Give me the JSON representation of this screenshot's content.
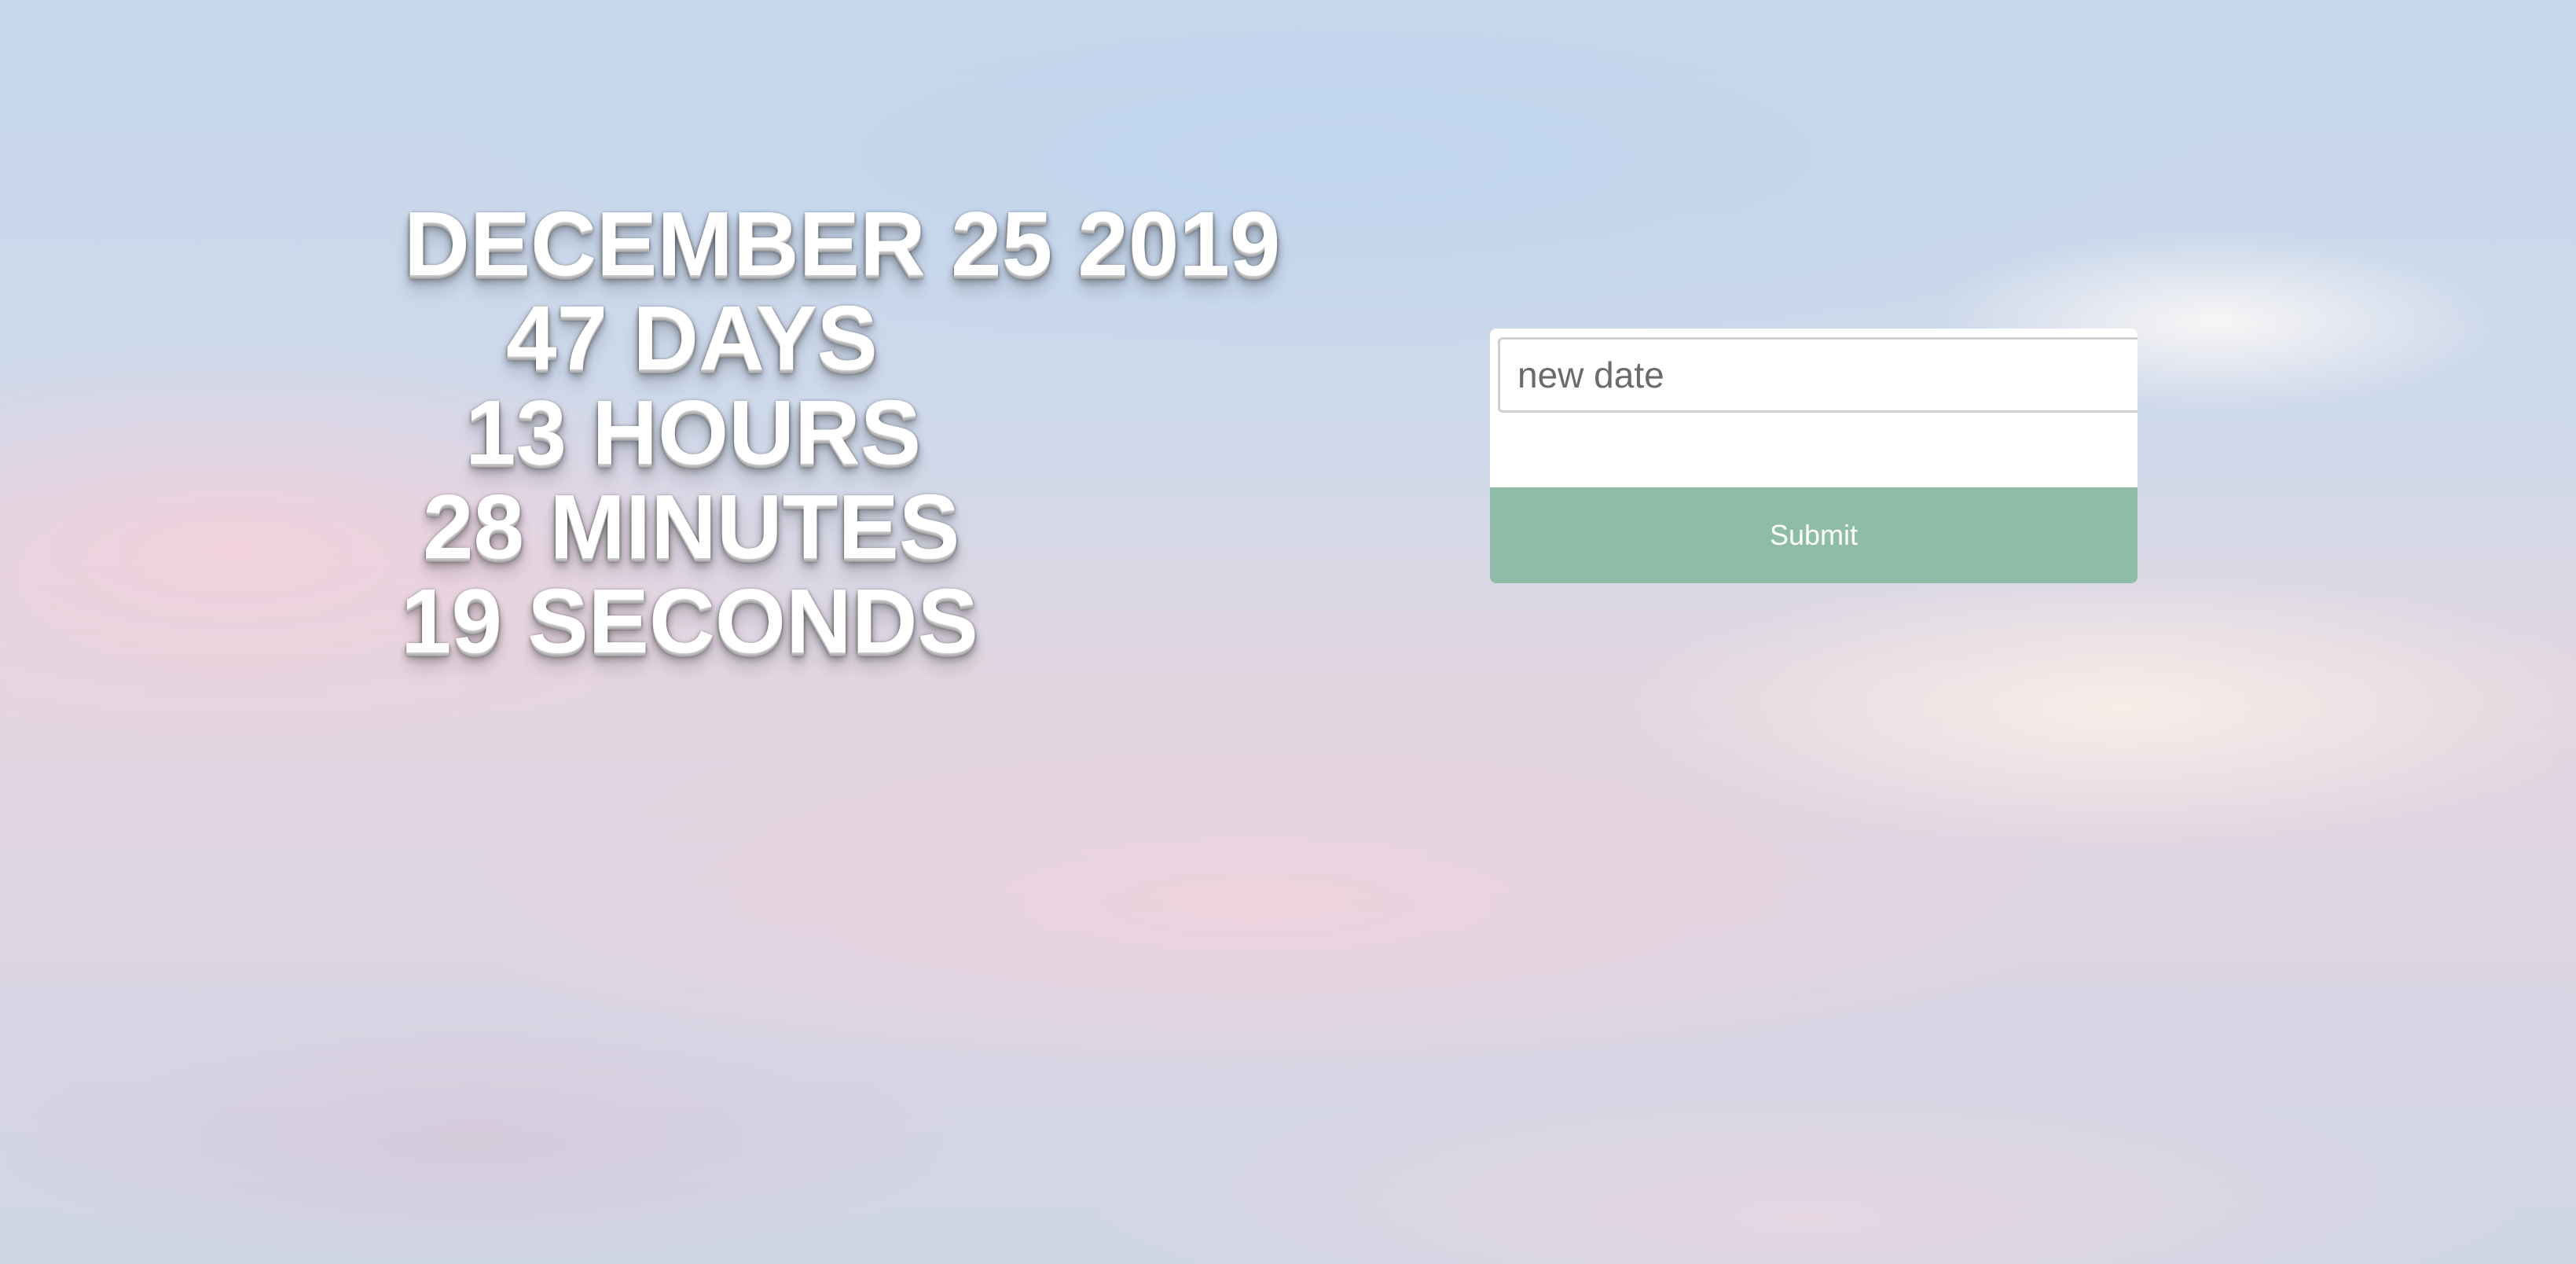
{
  "countdown": {
    "target_date": "DECEMBER 25 2019",
    "days": "47 DAYS",
    "hours": "13 HOURS",
    "minutes": "28 MINUTES",
    "seconds": "19 SECONDS"
  },
  "form": {
    "date_input_placeholder": "new date",
    "date_input_value": "",
    "submit_label": "Submit"
  },
  "colors": {
    "submit_button": "#8fbca6",
    "countdown_text": "#ffffff",
    "sky_blue": "#c6d8ec",
    "cloud_pink": "#f6d0da"
  }
}
